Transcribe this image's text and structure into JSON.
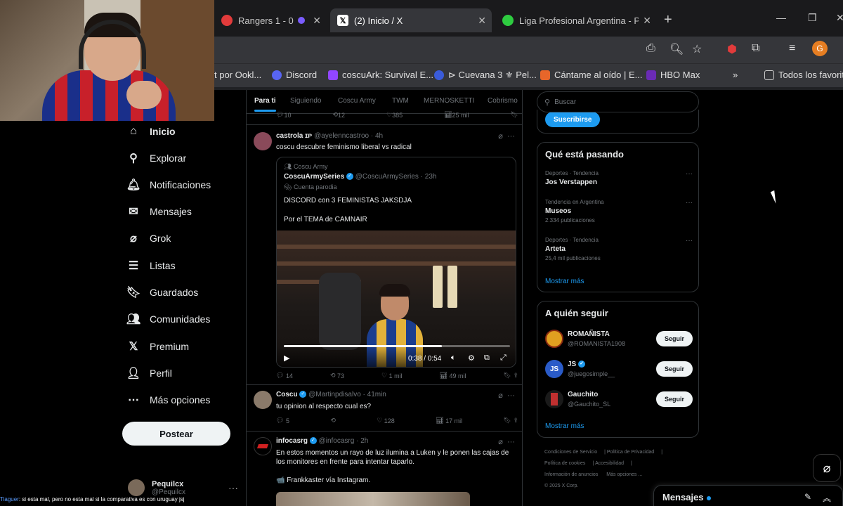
{
  "browser": {
    "tabs": [
      {
        "title": "Rangers 1 - 0",
        "active": false
      },
      {
        "title": "(2) Inicio / X",
        "active": true
      },
      {
        "title": "Liga Profesional Argentina - PO",
        "active": false
      }
    ],
    "profile_initial": "G",
    "bookmarks": [
      "t por Ookl...",
      "Discord",
      "coscuArk: Survival E...",
      "⊳ Cuevana 3 ⚜ Pel...",
      "Cántame al oído | E...",
      "HBO Max",
      "Todos los favoritos"
    ]
  },
  "sidebar": {
    "items": [
      {
        "label": "Inicio",
        "icon": "home-icon"
      },
      {
        "label": "Explorar",
        "icon": "search-icon"
      },
      {
        "label": "Notificaciones",
        "icon": "bell-icon"
      },
      {
        "label": "Mensajes",
        "icon": "mail-icon"
      },
      {
        "label": "Grok",
        "icon": "grok-icon"
      },
      {
        "label": "Listas",
        "icon": "list-icon"
      },
      {
        "label": "Guardados",
        "icon": "bookmark-icon"
      },
      {
        "label": "Comunidades",
        "icon": "communities-icon"
      },
      {
        "label": "Premium",
        "icon": "x-logo-icon"
      },
      {
        "label": "Perfil",
        "icon": "profile-icon"
      },
      {
        "label": "Más opciones",
        "icon": "more-options-icon"
      }
    ],
    "post_button": "Postear",
    "account": {
      "name": "Pequilcx",
      "handle": "@Pequilcx"
    }
  },
  "chat_overlay": {
    "user": "Tiaguer",
    "message": ": si esta mal, pero no esta mal si la comparativa es con uruguay jsj"
  },
  "feed": {
    "tabs": [
      "Para ti",
      "Siguiendo",
      "Coscu Army",
      "TWM",
      "MERNOSKETTI",
      "Cobrismo"
    ],
    "tweets": [
      {
        "name": "castrola ɪᴘ",
        "handle": "@ayelenncastroo · 4h",
        "text": "coscu descubre feminismo liberal vs radical",
        "quote": {
          "context": "Coscu Army",
          "name": "CoscuArmySeries",
          "handle": "@CoscuArmySeries · 23h",
          "parody": "Cuenta parodia",
          "line1": "DISCORD con 3 FEMINISTAS JAKSDJA",
          "line2": "Por el TEMA de CAMNAIR",
          "video_time": "0:38 / 0:54",
          "video_progress": 0.7
        },
        "actions": {
          "replies": "14",
          "retweets": "73",
          "likes": "1 mil",
          "views": "49 mil"
        }
      },
      {
        "name": "Coscu",
        "handle": "@Martinpdisalvo · 41min",
        "text": "tu opinion al respecto cual es?",
        "actions": {
          "replies": "5",
          "retweets": "",
          "likes": "128",
          "views": "17 mil"
        }
      },
      {
        "name": "infocasrg",
        "handle": "@infocasrg · 2h",
        "text1": "En estos momentos un rayo de luz ilumina a Luken y le ponen las cajas de",
        "text2": "los monitores en frente para intentar taparlo.",
        "text3": "📹 Frankkaster vía Instagram."
      }
    ],
    "prev_actions": {
      "replies": "10",
      "retweets": "12",
      "likes": "385",
      "views": "25 mil"
    }
  },
  "right": {
    "search_placeholder": "Buscar",
    "subscribe": "Suscribirse",
    "trending_title": "Qué está pasando",
    "trends": [
      {
        "context": "Deportes · Tendencia",
        "topic": "Jos Verstappen",
        "count": ""
      },
      {
        "context": "Tendencia en Argentina",
        "topic": "Museos",
        "count": "2.334 publicaciones"
      },
      {
        "context": "Deportes · Tendencia",
        "topic": "Arteta",
        "count": "25,4 mil publicaciones"
      }
    ],
    "show_more": "Mostrar más",
    "follow_title": "A quién seguir",
    "follow": [
      {
        "name": "ROMAÑISTA",
        "handle": "@ROMANISTA1908",
        "button": "Seguir"
      },
      {
        "name": "JS",
        "handle": "@juegosimple__",
        "button": "Seguir"
      },
      {
        "name": "Gauchito",
        "handle": "@Gauchito_SL",
        "button": "Seguir"
      }
    ],
    "footer": [
      "Condiciones de Servicio",
      "Política de Privacidad",
      "Política de cookies",
      "Accesibilidad",
      "Información de anuncios",
      "Más opciones ...",
      "© 2025 X Corp."
    ]
  },
  "messages_drawer": {
    "title": "Mensajes"
  },
  "colors": {
    "accent": "#1d9bf0",
    "background": "#000000",
    "text": "#e7e9ea",
    "muted": "#71767b"
  }
}
